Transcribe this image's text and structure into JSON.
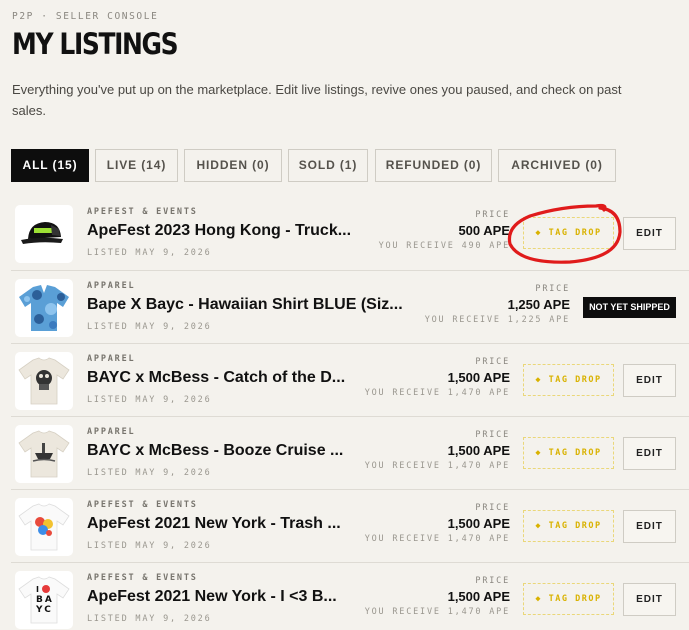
{
  "header": {
    "eyebrow": "P2P · SELLER CONSOLE",
    "title": "MY LISTINGS",
    "subtitle": "Everything you've put up on the marketplace. Edit live listings, revive ones you paused, and check on past sales."
  },
  "tabs": [
    {
      "label": "ALL (15)",
      "active": true
    },
    {
      "label": "LIVE (14)",
      "active": false
    },
    {
      "label": "HIDDEN (0)",
      "active": false
    },
    {
      "label": "SOLD (1)",
      "active": false
    },
    {
      "label": "REFUNDED (0)",
      "active": false
    },
    {
      "label": "ARCHIVED (0)",
      "active": false
    }
  ],
  "listings": [
    {
      "category": "APEFEST & EVENTS",
      "title": "ApeFest 2023 Hong Kong - Truck...",
      "date": "LISTED MAY 9, 2026",
      "price_label": "PRICE",
      "price": "500 APE",
      "receive": "YOU RECEIVE 490 APE",
      "action": "◆ TAG DROP",
      "edit": "EDIT",
      "thumb_icon": "black-trucker-hat"
    },
    {
      "category": "APPAREL",
      "title": "Bape X Bayc - Hawaiian Shirt BLUE (Siz...",
      "date": "LISTED MAY 9, 2026",
      "price_label": "PRICE",
      "price": "1,250 APE",
      "receive": "YOU RECEIVE 1,225 APE",
      "status": "NOT YET SHIPPED",
      "thumb_icon": "blue-camo-shirt"
    },
    {
      "category": "APPAREL",
      "title": "BAYC x McBess - Catch of the D...",
      "date": "LISTED MAY 9, 2026",
      "price_label": "PRICE",
      "price": "1,500 APE",
      "receive": "YOU RECEIVE 1,470 APE",
      "action": "◆ TAG DROP",
      "edit": "EDIT",
      "thumb_icon": "cream-tee-skull"
    },
    {
      "category": "APPAREL",
      "title": "BAYC x McBess - Booze Cruise ...",
      "date": "LISTED MAY 9, 2026",
      "price_label": "PRICE",
      "price": "1,500 APE",
      "receive": "YOU RECEIVE 1,470 APE",
      "action": "◆ TAG DROP",
      "edit": "EDIT",
      "thumb_icon": "cream-tee-boat"
    },
    {
      "category": "APEFEST & EVENTS",
      "title": "ApeFest 2021 New York - Trash ...",
      "date": "LISTED MAY 9, 2026",
      "price_label": "PRICE",
      "price": "1,500 APE",
      "receive": "YOU RECEIVE 1,470 APE",
      "action": "◆ TAG DROP",
      "edit": "EDIT",
      "thumb_icon": "white-tee-graphic"
    },
    {
      "category": "APEFEST & EVENTS",
      "title": "ApeFest 2021 New York - I <3 B...",
      "date": "LISTED MAY 9, 2026",
      "price_label": "PRICE",
      "price": "1,500 APE",
      "receive": "YOU RECEIVE 1,470 APE",
      "action": "◆ TAG DROP",
      "edit": "EDIT",
      "thumb_icon": "white-tee-i-heart-bayc",
      "thumb_text": [
        "I",
        "BA",
        "YC"
      ]
    }
  ],
  "colors": {
    "background": "#f4f2ed",
    "active_tab": "#0d0d0d",
    "tag_drop": "#d9b200",
    "annotation": "#e01b1b"
  }
}
